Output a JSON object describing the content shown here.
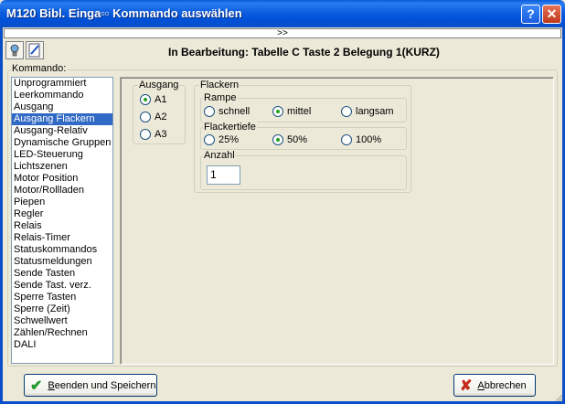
{
  "window": {
    "title": "M120 Bibl. Einga▫▫ Kommando auswählen",
    "help_label": "?",
    "close_label": "✕"
  },
  "expander": {
    "label": ">>"
  },
  "toolbar": {
    "status": "In Bearbeitung: Tabelle C Taste 2 Belegung 1(KURZ)"
  },
  "kommando": {
    "label": "Kommando:",
    "items": [
      "Unprogrammiert",
      "Leerkommando",
      "Ausgang",
      "Ausgang Flackern",
      "Ausgang-Relativ",
      "Dynamische Gruppen",
      "LED-Steuerung",
      "Lichtszenen",
      "Motor Position",
      "Motor/Rollladen",
      "Piepen",
      "Regler",
      "Relais",
      "Relais-Timer",
      "Statuskommandos",
      "Statusmeldungen",
      "Sende Tasten",
      "Sende Tast. verz.",
      "Sperre Tasten",
      "Sperre (Zeit)",
      "Schwellwert",
      "Zählen/Rechnen",
      "DALI"
    ],
    "selected_index": 3
  },
  "ausgang": {
    "legend": "Ausgang",
    "options": [
      {
        "label": "A1",
        "checked": true
      },
      {
        "label": "A2",
        "checked": false
      },
      {
        "label": "A3",
        "checked": false
      }
    ]
  },
  "flackern": {
    "legend": "Flackern",
    "rampe": {
      "legend": "Rampe",
      "options": [
        {
          "label": "schnell",
          "checked": false
        },
        {
          "label": "mittel",
          "checked": true
        },
        {
          "label": "langsam",
          "checked": false
        }
      ]
    },
    "flackertiefe": {
      "legend": "Flackertiefe",
      "options": [
        {
          "label": "25%",
          "checked": false
        },
        {
          "label": "50%",
          "checked": true
        },
        {
          "label": "100%",
          "checked": false
        }
      ]
    },
    "anzahl": {
      "legend": "Anzahl",
      "value": "1"
    }
  },
  "buttons": {
    "save": {
      "icon": "✔",
      "label_u": "B",
      "label_rest": "eenden und Speichern"
    },
    "cancel": {
      "icon": "✘",
      "label_u": "A",
      "label_rest": "bbrechen"
    }
  },
  "colors": {
    "titlebar": "#0a5bd9",
    "selection": "#316ac5",
    "dialog_bg": "#ece9d8"
  }
}
